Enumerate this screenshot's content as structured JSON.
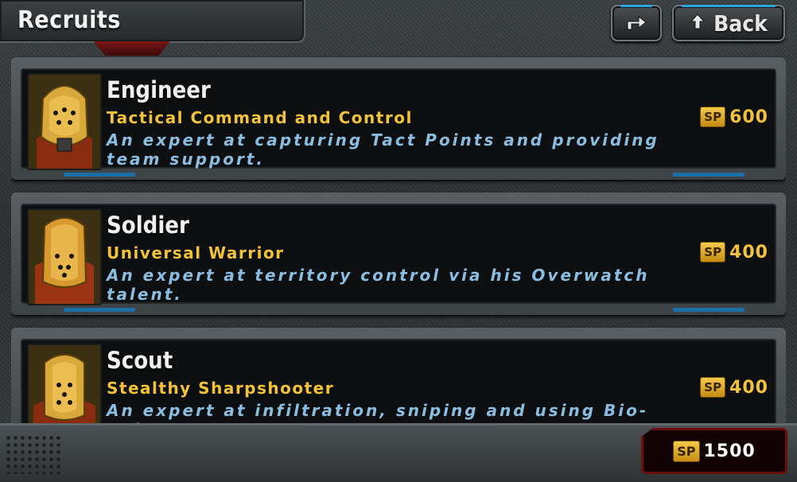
{
  "header": {
    "title": "Recruits",
    "back_label": "Back"
  },
  "currency": {
    "symbol": "SP",
    "balance": "1500"
  },
  "recruits": [
    {
      "name": "Engineer",
      "role": "Tactical Command and Control",
      "description": "An expert at capturing Tact Points and providing team support.",
      "cost": "600"
    },
    {
      "name": "Soldier",
      "role": "Universal Warrior",
      "description": "An expert at territory control via his Overwatch talent.",
      "cost": "400"
    },
    {
      "name": "Scout",
      "role": "Stealthy Sharpshooter",
      "description": "An expert at infiltration, sniping and using Bio-Poison weapons.",
      "cost": "400"
    }
  ],
  "icons": {
    "share": "share-arrow-icon",
    "back": "up-arrow-icon"
  },
  "colors": {
    "role_text": "#f2c33a",
    "description_text": "#8bbde0",
    "accent_blue": "#2aa7d8",
    "balance_border": "#6a0f0f"
  }
}
